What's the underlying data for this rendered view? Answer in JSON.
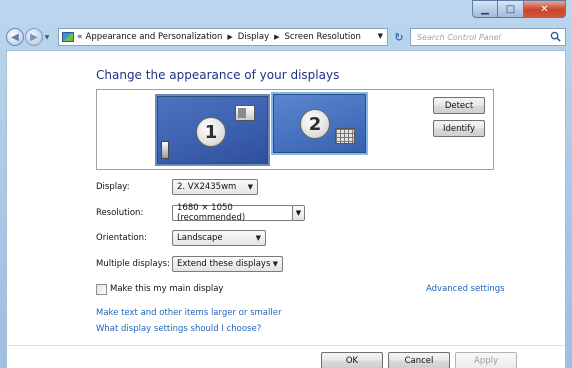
{
  "window": {
    "controls": {
      "minimize": "▁",
      "maximize": "□",
      "close": "✕"
    }
  },
  "nav": {
    "back_icon": "arrow-left-icon",
    "forward_icon": "arrow-right-icon",
    "back_glyph": "◀",
    "forward_glyph": "▶",
    "history_glyph": "▼",
    "address_prefix": "«",
    "breadcrumbs": [
      "Appearance and Personalization",
      "Display",
      "Screen Resolution"
    ],
    "crumb_sep": "▶",
    "address_drop": "▼",
    "refresh_glyph": "↻",
    "search_placeholder": "Search Control Panel"
  },
  "main": {
    "title": "Change the appearance of your displays",
    "monitors": [
      {
        "number": "1"
      },
      {
        "number": "2"
      }
    ],
    "detect_label": "Detect",
    "identify_label": "Identify",
    "fields": {
      "display": {
        "label": "Display:",
        "value": "2. VX2435wm"
      },
      "resolution": {
        "label": "Resolution:",
        "value": "1680 × 1050 (recommended)"
      },
      "orientation": {
        "label": "Orientation:",
        "value": "Landscape"
      },
      "multiple": {
        "label": "Multiple displays:",
        "value": "Extend these displays"
      }
    },
    "select_arrow": "▼",
    "main_display_label": "Make this my main display",
    "main_display_checked": false,
    "advanced_settings": "Advanced settings",
    "link_text_size": "Make text and other items larger or smaller",
    "link_help": "What display settings should I choose?"
  },
  "footer": {
    "ok": "OK",
    "cancel": "Cancel",
    "apply": "Apply"
  },
  "colors": {
    "title": "#1e3287",
    "link": "#1e66b8",
    "frame": "#a7c7e6"
  }
}
